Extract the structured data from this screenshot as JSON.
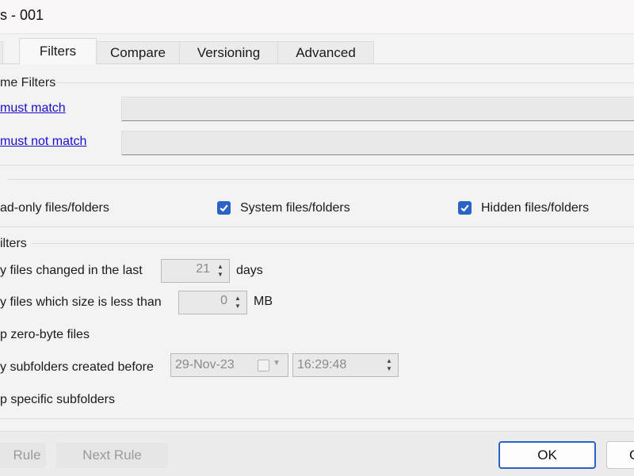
{
  "window": {
    "title": "s - 001"
  },
  "tabs": [
    {
      "label": ""
    },
    {
      "label": "Filters"
    },
    {
      "label": "Compare"
    },
    {
      "label": "Versioning"
    },
    {
      "label": "Advanced"
    }
  ],
  "name_filters": {
    "title": "me Filters",
    "must_match_label": "must match",
    "must_match_value": "",
    "must_not_match_label": "must not match",
    "must_not_match_value": ""
  },
  "attributes": {
    "readonly_label": "ad-only files/folders",
    "system_label": "System files/folders",
    "system_checked": true,
    "hidden_label": "Hidden files/folders",
    "hidden_checked": true
  },
  "other_filters": {
    "title": "ilters",
    "changed_label": "y files changed in the last",
    "changed_value": "21",
    "changed_unit": "days",
    "size_label": "y files which size is less than",
    "size_value": "0",
    "size_unit": "MB",
    "zero_byte_label": "p zero-byte files",
    "subfolders_before_label": "y subfolders created before",
    "date_value": "29-Nov-23",
    "time_value": "16:29:48",
    "specific_subfolders_label": "p specific subfolders"
  },
  "footer": {
    "prev_rule_label": "Rule",
    "next_rule_label": "Next Rule",
    "ok_label": "OK",
    "cancel_label": "C"
  }
}
